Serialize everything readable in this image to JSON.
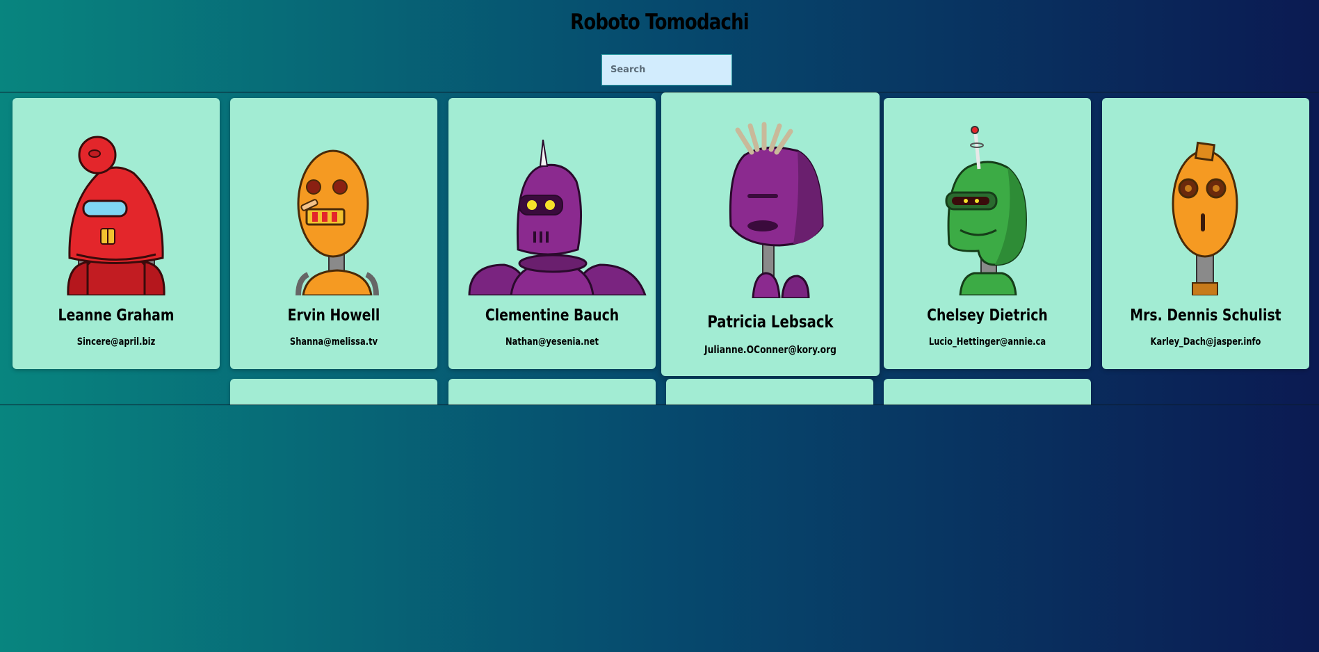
{
  "app": {
    "title": "Roboto Tomodachi"
  },
  "search": {
    "placeholder": "Search"
  },
  "robots": [
    {
      "name": "Leanne Graham",
      "email": "Sincere@april.biz",
      "color": "#e3262b"
    },
    {
      "name": "Ervin Howell",
      "email": "Shanna@melissa.tv",
      "color": "#f59a22"
    },
    {
      "name": "Clementine Bauch",
      "email": "Nathan@yesenia.net",
      "color": "#8b2a8f"
    },
    {
      "name": "Patricia Lebsack",
      "email": "Julianne.OConner@kory.org",
      "color": "#8b2a8f"
    },
    {
      "name": "Chelsey Dietrich",
      "email": "Lucio_Hettinger@annie.ca",
      "color": "#3cab45"
    },
    {
      "name": "Mrs. Dennis Schulist",
      "email": "Karley_Dach@jasper.info",
      "color": "#f59a22"
    }
  ],
  "colors": {
    "card_bg": "#a2ecd3",
    "search_bg": "#d2ecfd",
    "gradient_start": "#08857f",
    "gradient_end": "#0b1a52"
  }
}
